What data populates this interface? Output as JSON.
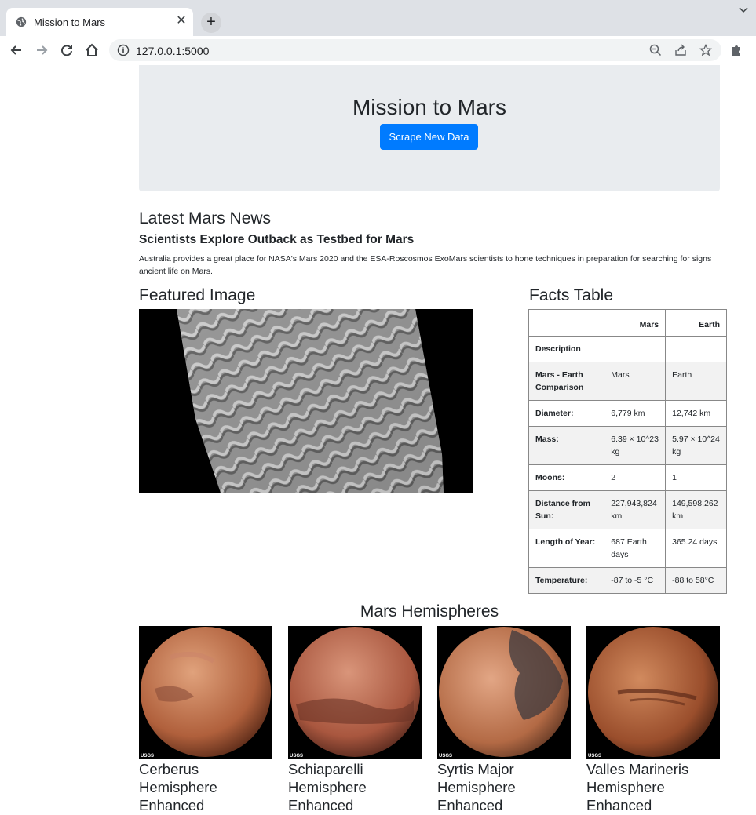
{
  "browser": {
    "tab_title": "Mission to Mars",
    "url": "127.0.0.1:5000",
    "icons": [
      "globe-icon",
      "close-icon",
      "plus-icon",
      "chevron-down-icon",
      "back-arrow-icon",
      "forward-arrow-icon",
      "reload-icon",
      "home-icon",
      "info-icon",
      "zoom-icon",
      "share-icon",
      "star-icon",
      "puzzle-icon"
    ]
  },
  "jumbotron": {
    "title": "Mission to Mars",
    "button_label": "Scrape New Data",
    "button_color": "#007bff"
  },
  "news": {
    "heading": "Latest Mars News",
    "title": "Scientists Explore Outback as Testbed for Mars",
    "paragraph": "Australia provides a great place for NASA's Mars 2020 and the ESA-Roscosmos ExoMars scientists to hone techniques in preparation for searching for signs ancient life on Mars."
  },
  "featured": {
    "heading": "Featured Image"
  },
  "facts": {
    "heading": "Facts Table",
    "columns": [
      "",
      "Mars",
      "Earth"
    ],
    "rows": [
      [
        "Description",
        "",
        ""
      ],
      [
        "Mars - Earth Comparison",
        "Mars",
        "Earth"
      ],
      [
        "Diameter:",
        "6,779 km",
        "12,742 km"
      ],
      [
        "Mass:",
        "6.39 × 10^23 kg",
        "5.97 × 10^24 kg"
      ],
      [
        "Moons:",
        "2",
        "1"
      ],
      [
        "Distance from Sun:",
        "227,943,824 km",
        "149,598,262 km"
      ],
      [
        "Length of Year:",
        "687 Earth days",
        "365.24 days"
      ],
      [
        "Temperature:",
        "-87 to -5 °C",
        "-88 to 58°C"
      ]
    ]
  },
  "hemispheres": {
    "heading": "Mars Hemispheres",
    "items": [
      {
        "title": "Cerberus Hemisphere Enhanced",
        "watermark": "USGS"
      },
      {
        "title": "Schiaparelli Hemisphere Enhanced",
        "watermark": "USGS"
      },
      {
        "title": "Syrtis Major Hemisphere Enhanced",
        "watermark": "USGS"
      },
      {
        "title": "Valles Marineris Hemisphere Enhanced",
        "watermark": "USGS"
      }
    ]
  }
}
